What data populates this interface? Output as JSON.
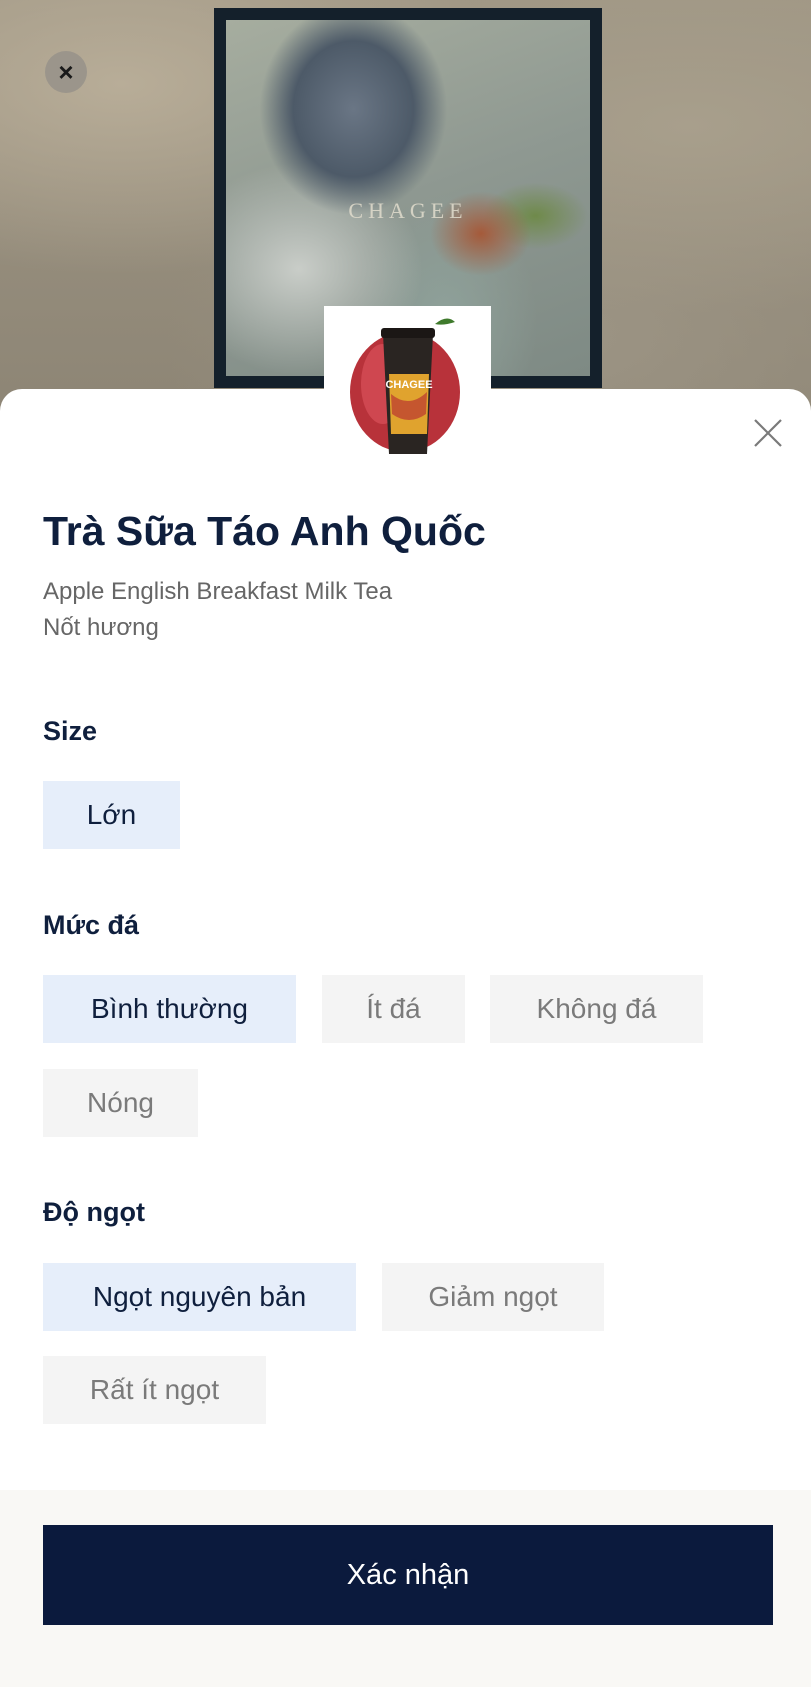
{
  "background": {
    "brand_watermark": "CHAGEE"
  },
  "product": {
    "image_icon": "milk-tea-cup-with-apple",
    "cup_brand": "CHAGEE",
    "name": "Trà Sữa Táo Anh Quốc",
    "english_name": "Apple English Breakfast Milk Tea",
    "notes_label": "Nốt hương"
  },
  "options": {
    "size": {
      "title": "Size",
      "choices": [
        {
          "label": "Lớn",
          "selected": true
        }
      ]
    },
    "ice": {
      "title": "Mức đá",
      "choices": [
        {
          "label": "Bình thường",
          "selected": true
        },
        {
          "label": "Ít đá",
          "selected": false
        },
        {
          "label": "Không đá",
          "selected": false
        },
        {
          "label": "Nóng",
          "selected": false
        }
      ]
    },
    "sweetness": {
      "title": "Độ ngọt",
      "choices": [
        {
          "label": "Ngọt nguyên bản",
          "selected": true
        },
        {
          "label": "Giảm ngọt",
          "selected": false
        },
        {
          "label": "Rất ít ngọt",
          "selected": false
        }
      ]
    }
  },
  "actions": {
    "confirm_label": "Xác nhận"
  },
  "colors": {
    "primary_navy": "#0b1a3d",
    "title_text": "#0f1f3d",
    "selected_chip_bg": "#e6eefa",
    "unselected_chip_bg": "#f4f4f4",
    "unselected_chip_text": "#7a7a7a"
  }
}
